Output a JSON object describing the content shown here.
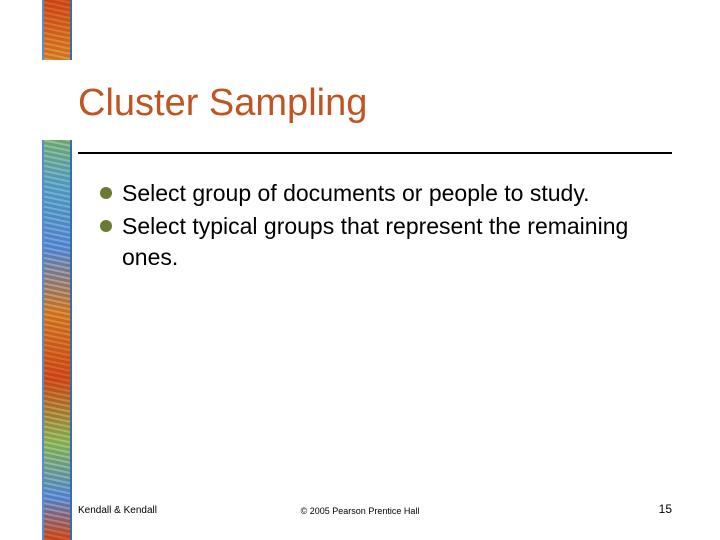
{
  "title": "Cluster Sampling",
  "bullets": [
    "Select group of documents or people to study.",
    "Select typical groups that represent the remaining ones."
  ],
  "footer": {
    "left": "Kendall & Kendall",
    "center": "© 2005 Pearson Prentice Hall",
    "page": "15"
  },
  "colors": {
    "title": "#c05522",
    "bullet": "#6a7a32"
  }
}
